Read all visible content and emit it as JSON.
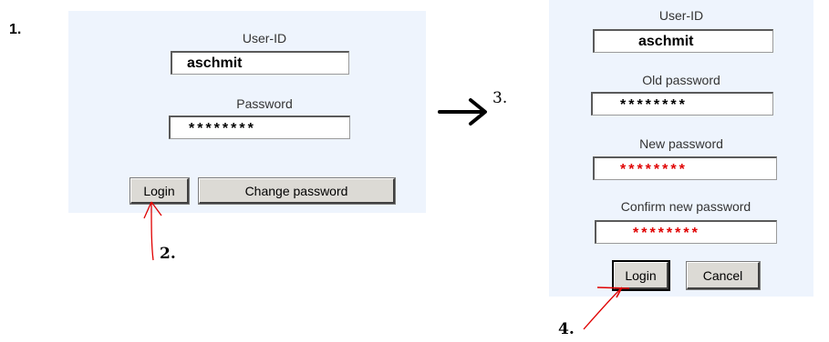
{
  "steps": {
    "one": "1.",
    "two": "2.",
    "three": "3.",
    "four": "4."
  },
  "login_form": {
    "userid_label": "User-ID",
    "userid_value": "aschmit",
    "password_label": "Password",
    "password_value": "********",
    "login_button": "Login",
    "change_password_button": "Change password"
  },
  "change_form": {
    "userid_label": "User-ID",
    "userid_value": "aschmit",
    "old_password_label": "Old password",
    "old_password_value": "********",
    "new_password_label": "New password",
    "new_password_value": "********",
    "confirm_password_label": "Confirm new password",
    "confirm_password_value": "********",
    "login_button": "Login",
    "cancel_button": "Cancel"
  },
  "colors": {
    "panel_bg": "#eef4fd",
    "annotation_red": "#e00000",
    "mask_red": "#e00000"
  },
  "icons": [
    "arrow-right-icon",
    "red-pointer-arrow-icon"
  ]
}
